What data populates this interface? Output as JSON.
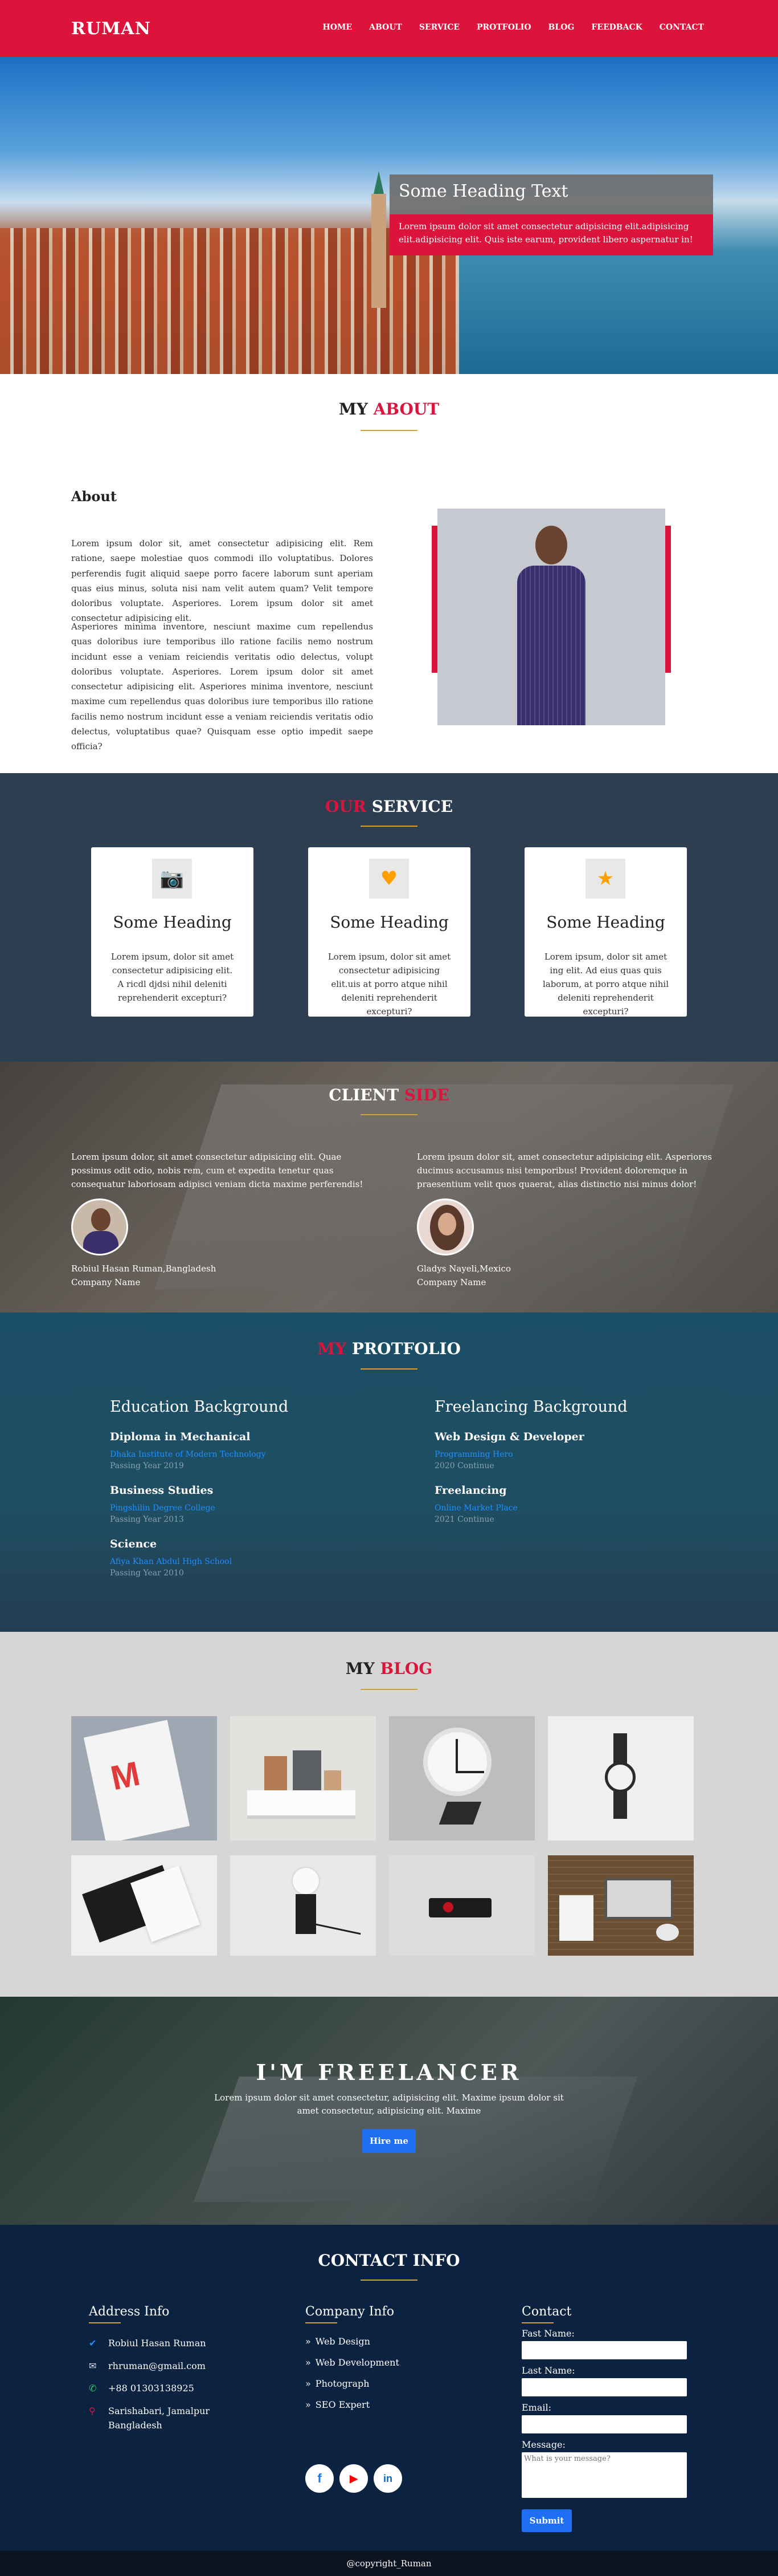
{
  "header": {
    "logo": "RUMAN",
    "nav": [
      "HOME",
      "ABOUT",
      "SERVICE",
      "PROTFOLIO",
      "BLOG",
      "FEEDBACK",
      "CONTACT"
    ]
  },
  "hero": {
    "title": "Some Heading Text",
    "text": "Lorem ipsum dolor sit amet consectetur adipisicing elit.adipisicing elit.adipisicing elit. Quis iste earum, provident libero aspernatur in!"
  },
  "about": {
    "title_plain": "MY ",
    "title_accent": "ABOUT",
    "heading": "About",
    "para1": "Lorem ipsum dolor sit, amet consectetur adipisicing elit. Rem ratione, saepe molestiae quos commodi illo voluptatibus. Dolores perferendis fugit aliquid saepe porro facere laborum sunt aperiam quas eius minus, soluta nisi nam velit autem quam? Velit tempore doloribus voluptate. Asperiores. Lorem ipsum dolor sit amet consectetur adipisicing elit.",
    "para2": "Asperiores minima inventore, nesciunt maxime cum repellendus quas doloribus iure temporibus illo ratione facilis nemo nostrum incidunt esse a veniam reiciendis veritatis odio delectus, volupt doloribus voluptate. Asperiores. Lorem ipsum dolor sit amet consectetur adipisicing elit. Asperiores minima inventore, nesciunt maxime cum repellendus quas doloribus iure temporibus illo ratione facilis nemo nostrum incidunt esse a veniam reiciendis veritatis odio delectus, voluptatibus quae? Quisquam esse optio impedit saepe officia?"
  },
  "service": {
    "title_accent": "OUR ",
    "title_plain": "SERVICE",
    "cards": [
      {
        "icon": "camera-icon",
        "glyph": "📷",
        "heading": "Some Heading",
        "text": "Lorem ipsum, dolor sit amet consectetur adipisicing elit. A ricdl djdsi nihil deleniti reprehenderit excepturi?"
      },
      {
        "icon": "heart-icon",
        "glyph": "♥",
        "heading": "Some Heading",
        "text": "Lorem ipsum, dolor sit amet consectetur adipisicing elit.uis at porro atque nihil deleniti reprehenderit excepturi?"
      },
      {
        "icon": "star-icon",
        "glyph": "★",
        "heading": "Some Heading",
        "text": "Lorem ipsum, dolor sit amet ing elit. Ad eius quas quis laborum, at porro atque nihil deleniti reprehenderit excepturi?"
      }
    ]
  },
  "client": {
    "title_plain": "CLIENT ",
    "title_accent": "SIDE",
    "testimonials": [
      {
        "text": "Lorem ipsum dolor, sit amet consectetur adipisicing elit. Quae possimus odit odio, nobis rem, cum et expedita tenetur quas consequatur laboriosam adipisci veniam dicta maxime perferendis!",
        "name": "Robiul Hasan Ruman,Bangladesh",
        "company": "Company Name"
      },
      {
        "text": "Lorem ipsum dolor sit, amet consectetur adipisicing elit. Asperiores ducimus accusamus nisi temporibus! Provident doloremque in praesentium velit quos quaerat, alias distinctio nisi minus dolor!",
        "name": "Gladys Nayeli,Mexico",
        "company": "Company Name"
      }
    ]
  },
  "portfolio": {
    "title_accent": "MY ",
    "title_plain": "PROTFOLIO",
    "columns": [
      {
        "heading": "Education Background",
        "items": [
          {
            "title": "Diploma in Mechanical",
            "sub": "Dhaka Institute of Modern Technology",
            "year": "Passing Year 2019"
          },
          {
            "title": "Business Studies",
            "sub": "Pingshilin Degree College",
            "year": "Passing Year 2013"
          },
          {
            "title": "Science",
            "sub": "Afiya Khan Abdul High School",
            "year": "Passing Year 2010"
          }
        ]
      },
      {
        "heading": "Freelancing Background",
        "items": [
          {
            "title": "Web Design & Developer",
            "sub": "Programming Hero",
            "year": "2020 Continue"
          },
          {
            "title": "Freelancing",
            "sub": "Online Market Place",
            "year": "2021 Continue"
          }
        ]
      }
    ]
  },
  "blog": {
    "title_plain": "MY ",
    "title_accent": "BLOG"
  },
  "freelancer": {
    "title": "I'M FREELANCER",
    "text": "Lorem ipsum dolor sit amet consectetur, adipisicing elit. Maxime ipsum dolor sit amet consectetur, adipisicing elit. Maxime",
    "button": "Hire me"
  },
  "contact": {
    "title": "CONTACT INFO",
    "address": {
      "heading": "Address Info",
      "rows": [
        {
          "icon": "user-icon",
          "glyph": "✔",
          "text": "Robiul Hasan Ruman"
        },
        {
          "icon": "mail-icon",
          "glyph": "✉",
          "text": "rhruman@gmail.com"
        },
        {
          "icon": "phone-icon",
          "glyph": "✆",
          "text": "+88 01303138925"
        },
        {
          "icon": "location-icon",
          "glyph": "⚲",
          "text": "Sarishabari, Jamalpur Bangladesh"
        }
      ]
    },
    "company": {
      "heading": "Company Info",
      "links": [
        "Web Design",
        "Web Development",
        "Photograph",
        "SEO Expert"
      ]
    },
    "social": [
      {
        "icon": "facebook-icon",
        "glyph": "f",
        "color": "#1877f2"
      },
      {
        "icon": "youtube-icon",
        "glyph": "▶",
        "color": "#ff0000"
      },
      {
        "icon": "linkedin-icon",
        "glyph": "in",
        "color": "#0a66c2"
      }
    ],
    "form": {
      "heading": "Contact",
      "first_label": "Fast Name:",
      "last_label": "Last Name:",
      "email_label": "Email:",
      "message_label": "Message:",
      "message_placeholder": "What is your message?",
      "submit": "Submit"
    }
  },
  "footer": {
    "text": "@copyright_Ruman"
  },
  "colors": {
    "accent": "#dc143c",
    "underline": "#d4a033",
    "button": "#1e6ff3",
    "link": "#1e90ff"
  }
}
